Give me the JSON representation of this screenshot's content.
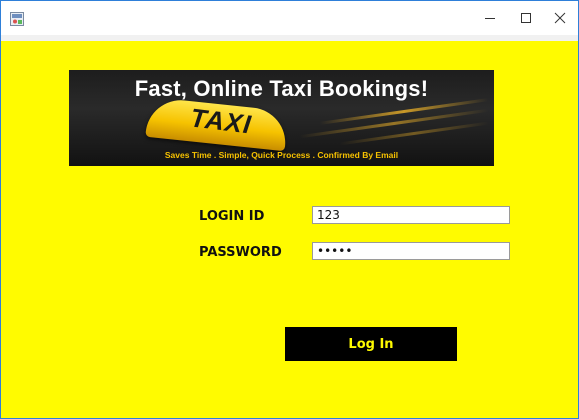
{
  "window": {
    "minimize_glyph": "–",
    "maximize_glyph": "☐",
    "close_glyph": "✕",
    "icon": "java-app-icon"
  },
  "banner": {
    "title": "Fast, Online Taxi Bookings!",
    "sign_text": "TAXI",
    "tagline": "Saves Time . Simple, Quick Process . Confirmed By Email"
  },
  "form": {
    "login_label": "LOGIN ID",
    "login_value": "123",
    "password_label": "PASSWORD",
    "password_value": "•••••",
    "submit_label": "Log In"
  },
  "colors": {
    "background": "#fffb00",
    "button": "#000000",
    "button_text": "#fffb00",
    "accent_border": "#2e7fd9"
  }
}
